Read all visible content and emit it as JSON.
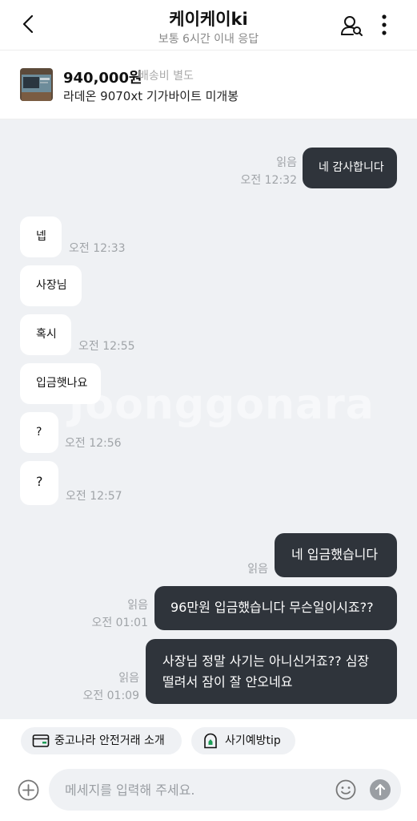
{
  "header": {
    "title": "케이케이ki",
    "subtitle": "보통 6시간 이내 응답"
  },
  "product": {
    "price": "940,000원",
    "shipping": "배송비 별도",
    "name": "라데온 9070xt 기가바이트 미개봉"
  },
  "watermark": "Joonggonara",
  "messages": [
    {
      "side": "mine",
      "text": "네 감사합니다",
      "read": "읽음",
      "time": "오전 12:32"
    },
    {
      "side": "theirs",
      "text": "넵",
      "time": "오전 12:33"
    },
    {
      "side": "theirs",
      "text": "사장님",
      "time": ""
    },
    {
      "side": "theirs",
      "text": "혹시",
      "time": "오전 12:55"
    },
    {
      "side": "theirs",
      "text": "입금햇나요",
      "time": ""
    },
    {
      "side": "theirs",
      "text": "?",
      "time": "오전 12:56"
    },
    {
      "side": "theirs",
      "text": "?",
      "time": "오전 12:57"
    },
    {
      "side": "mine",
      "text": "네 입금했습니다",
      "read": "읽음",
      "time": ""
    },
    {
      "side": "mine",
      "text": "96만원 입금했습니다 무슨일이시죠??",
      "read": "읽음",
      "time": "오전 01:01"
    },
    {
      "side": "mine",
      "text": "사장님 정말 사기는 아니신거죠?? 심장\n떨려서 잠이 잘 안오네요",
      "read": "읽음",
      "time": "오전 01:09"
    }
  ],
  "chips": {
    "safe_trade": "중고나라 안전거래 소개",
    "fraud_tip": "사기예방tip"
  },
  "composer": {
    "placeholder": "메세지를 입력해 주세요."
  },
  "colors": {
    "my_bubble": "#2f343b",
    "chat_bg": "#eff1f4",
    "fraud_icon": "#1e9e57"
  }
}
